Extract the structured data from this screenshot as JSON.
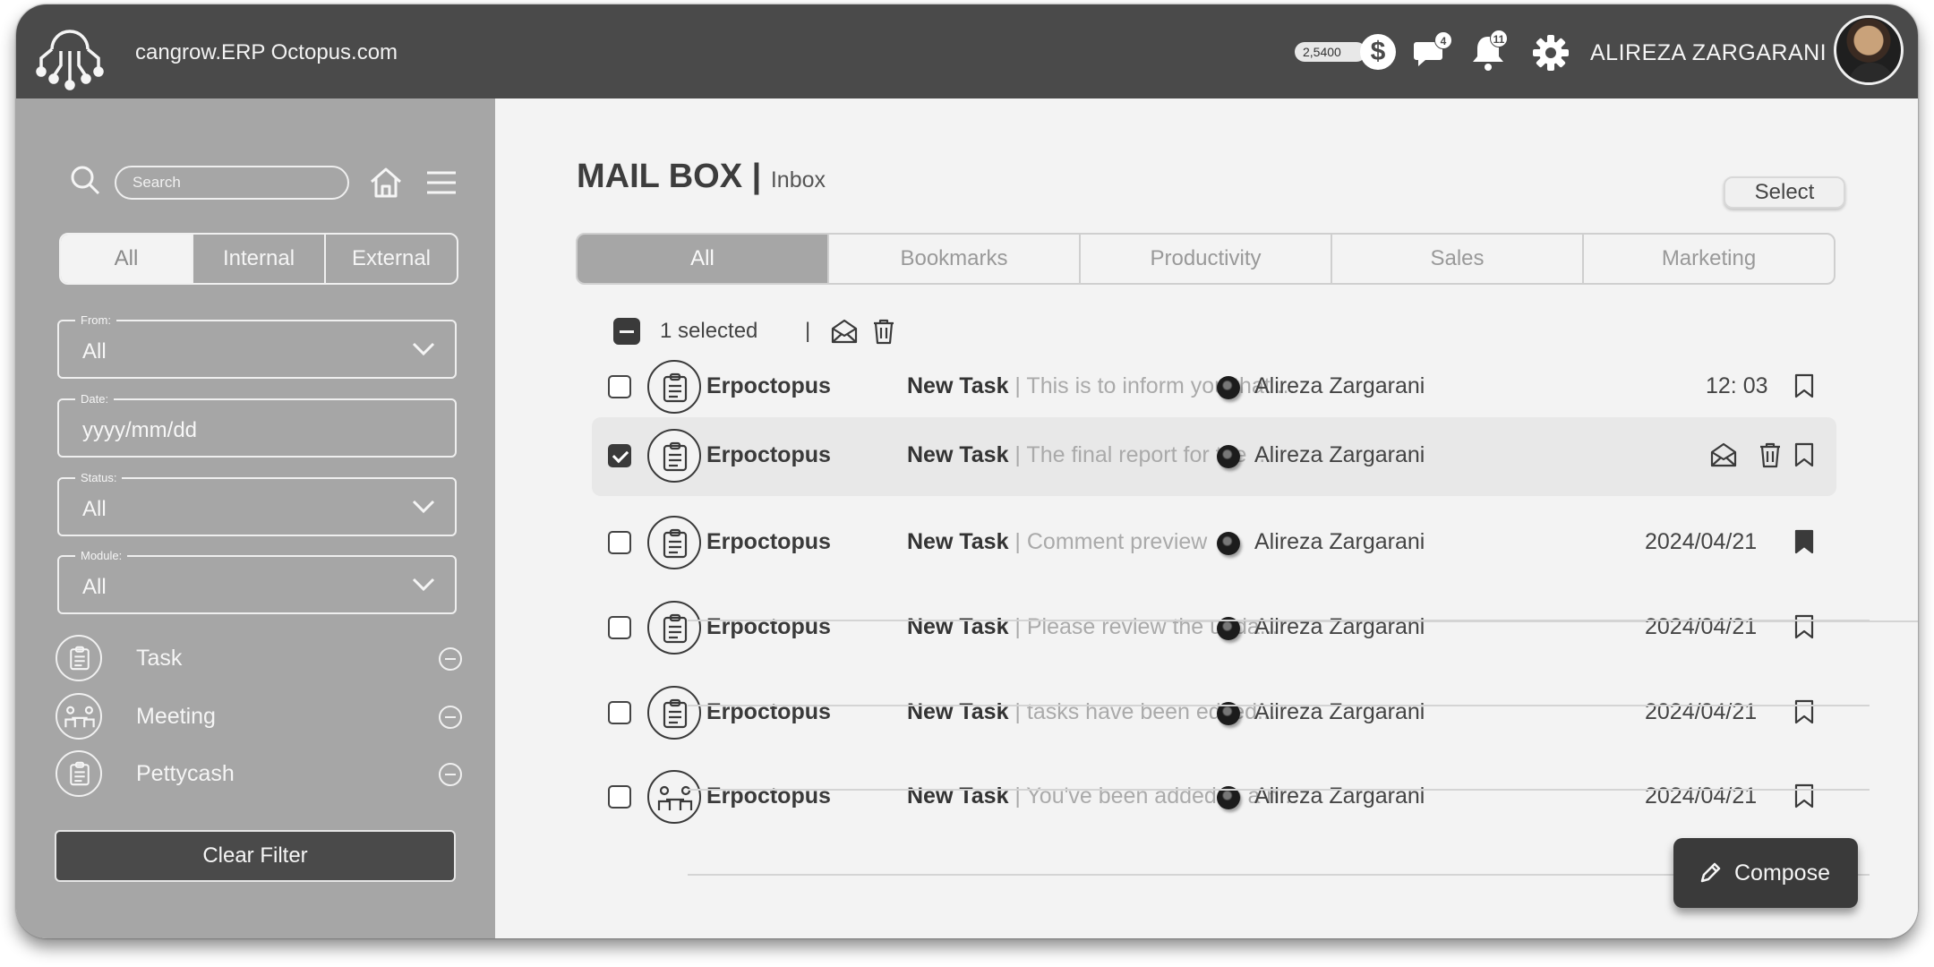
{
  "topbar": {
    "brand": "cangrow.ERP Octopus.com",
    "balance": "2,5400",
    "balance_symbol": "$",
    "messages_badge": "4",
    "notifications_badge": "11",
    "user_name": "ALIREZA ZARGARANI"
  },
  "sidebar": {
    "search_placeholder": "Search",
    "segments": [
      "All",
      "Internal",
      "External"
    ],
    "filters": {
      "from": {
        "label": "From:",
        "value": "All"
      },
      "date": {
        "label": "Date:",
        "value": "yyyy/mm/dd"
      },
      "status": {
        "label": "Status:",
        "value": "All"
      },
      "module": {
        "label": "Module:",
        "value": "All"
      }
    },
    "modules": [
      "Task",
      "Meeting",
      "Pettycash"
    ],
    "clear_filter": "Clear Filter"
  },
  "main": {
    "title": "MAIL BOX",
    "title_sep": "|",
    "subtitle": "Inbox",
    "select_button": "Select",
    "tabs": [
      "All",
      "Bookmarks",
      "Productivity",
      "Sales",
      "Marketing"
    ],
    "selection": {
      "count_text": "1 selected",
      "separator": "|"
    },
    "mails": [
      {
        "sender": "Erpoctopus",
        "subject": "New Task",
        "preview": "This is to inform you that ...",
        "recipient": "Alireza Zargarani",
        "date": "12: 03",
        "checked": false,
        "bookmarked": false,
        "icon": "task"
      },
      {
        "sender": "Erpoctopus",
        "subject": "New Task",
        "preview": "The final report for the ...",
        "recipient": "Alireza Zargarani",
        "date": "",
        "checked": true,
        "bookmarked": false,
        "icon": "task"
      },
      {
        "sender": "Erpoctopus",
        "subject": "New Task",
        "preview": "Comment preview",
        "recipient": "Alireza Zargarani",
        "date": "2024/04/21",
        "checked": false,
        "bookmarked": true,
        "icon": "task"
      },
      {
        "sender": "Erpoctopus",
        "subject": "New Task",
        "preview": "Please review the upda...",
        "recipient": "Alireza Zargarani",
        "date": "2024/04/21",
        "checked": false,
        "bookmarked": false,
        "icon": "task"
      },
      {
        "sender": "Erpoctopus",
        "subject": "New Task",
        "preview": "tasks have been edited...",
        "recipient": "Alireza Zargarani",
        "date": "2024/04/21",
        "checked": false,
        "bookmarked": false,
        "icon": "task"
      },
      {
        "sender": "Erpoctopus",
        "subject": "New Task",
        "preview": "You've been added to a n...",
        "recipient": "Alireza Zargarani",
        "date": "2024/04/21",
        "checked": false,
        "bookmarked": false,
        "icon": "meeting"
      }
    ],
    "compose": "Compose"
  },
  "colors": {
    "topbar": "#4a4a4a",
    "sidebar": "#a6a6a6",
    "main": "#f3f3f3",
    "accent_dark": "#3a3a3a"
  }
}
